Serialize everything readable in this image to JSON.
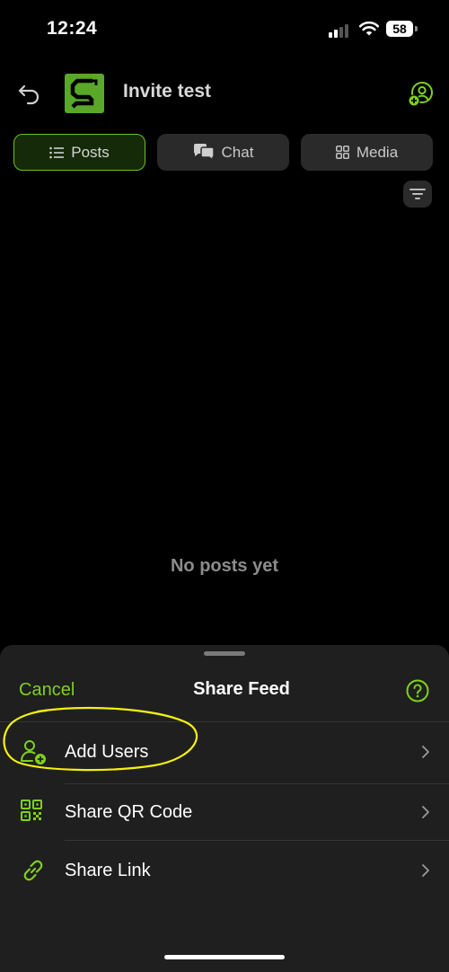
{
  "status_bar": {
    "time": "12:24",
    "battery": "58"
  },
  "header": {
    "title": "Invite test",
    "back_icon": "back-arrow-icon",
    "logo_icon": "app-logo-icon",
    "action_icon": "add-member-icon"
  },
  "tabs": [
    {
      "label": "Posts",
      "icon": "list-icon",
      "active": true
    },
    {
      "label": "Chat",
      "icon": "chat-bubbles-icon",
      "active": false
    },
    {
      "label": "Media",
      "icon": "grid-icon",
      "active": false
    }
  ],
  "filter_icon": "filter-icon",
  "empty_state": "No posts yet",
  "sheet": {
    "cancel_label": "Cancel",
    "title": "Share Feed",
    "help_icon": "help-icon",
    "items": [
      {
        "label": "Add Users",
        "icon": "add-user-icon"
      },
      {
        "label": "Share QR Code",
        "icon": "qr-code-icon"
      },
      {
        "label": "Share Link",
        "icon": "link-icon"
      }
    ]
  },
  "colors": {
    "accent": "#7fd11a",
    "background": "#000000",
    "sheet_background": "#1f1f1f",
    "highlight_annotation": "#f5f20a"
  }
}
